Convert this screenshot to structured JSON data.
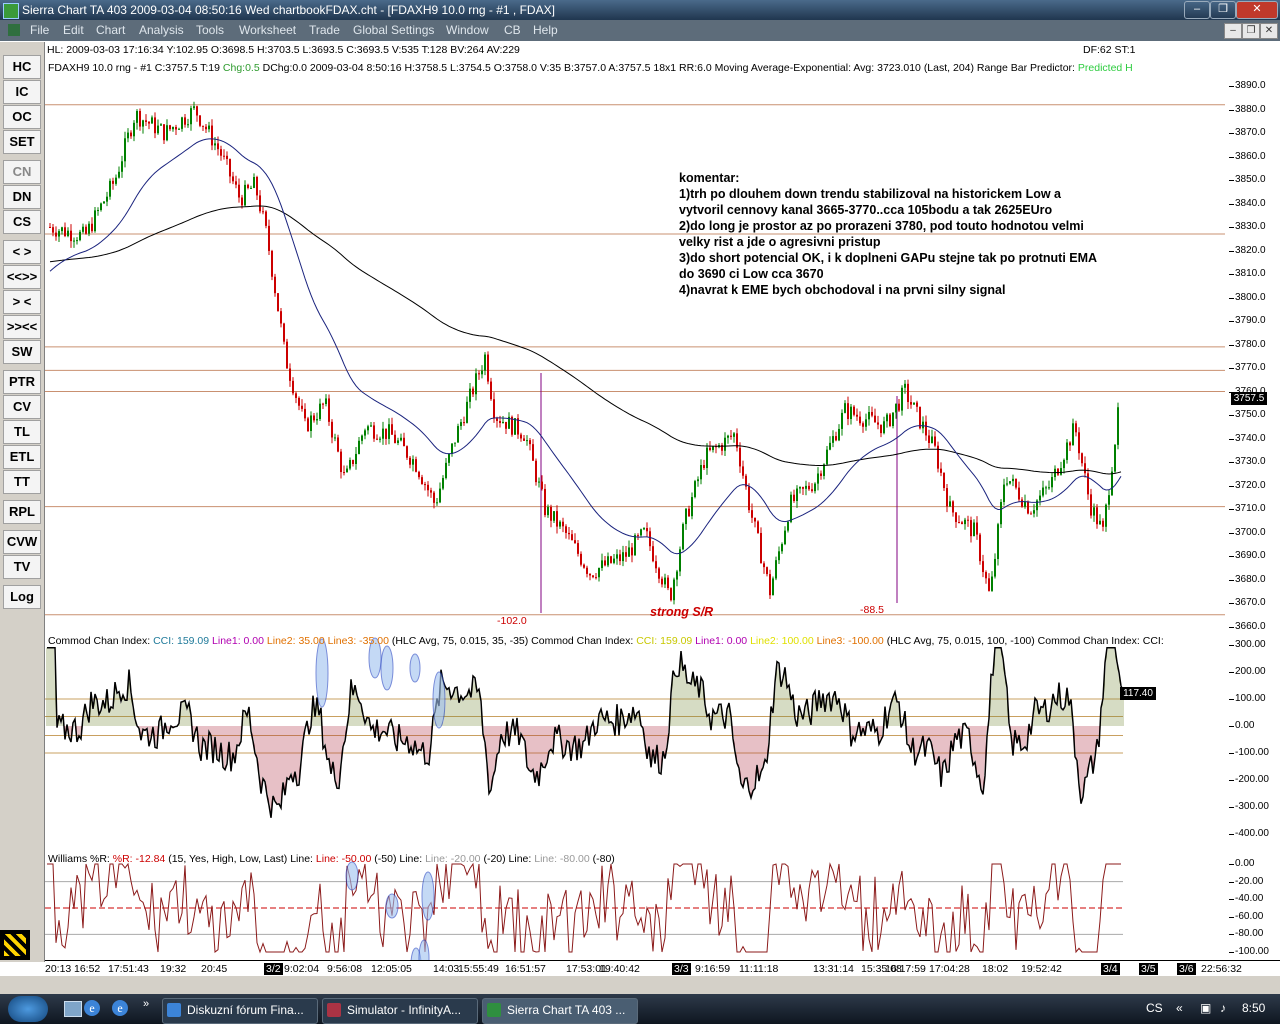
{
  "window": {
    "title": "Sierra Chart TA 403   2009-03-04  08:50:16  Wed   chartbookFDAX.cht - [FDAXH9  10.0 rng - #1 , FDAX]",
    "buttons": [
      "minimize-icon",
      "restore-icon",
      "close-icon"
    ]
  },
  "menu": {
    "items": [
      "File",
      "Edit",
      "Chart",
      "Analysis",
      "Tools",
      "Worksheet",
      "Trade",
      "Global Settings",
      "Window",
      "CB",
      "Help"
    ]
  },
  "infobar": {
    "left": "HL: 2009-03-03  17:16:34  Y:102.95  O:3698.5  H:3703.5  L:3693.5  C:3693.5  V:535  T:128  BV:264  AV:229",
    "right": "DF:62  ST:1"
  },
  "toolbar": {
    "buttons": [
      "HC",
      "IC",
      "OC",
      "SET",
      "CN",
      "DN",
      "CS",
      "< >",
      "<<>>",
      "> <",
      ">><<",
      "SW",
      "PTR",
      "CV",
      "TL",
      "ETL",
      "TT",
      "RPL",
      "CVW",
      "TV",
      "Log"
    ]
  },
  "price_chart": {
    "header_pre": "FDAXH9  10.0 rng - #1  C:3757.5  T:19  ",
    "header_chg": "Chg:0.5",
    "header_post": "  DChg:0.0  2009-03-04  8:50:16  H:3758.5  L:3754.5  O:3758.0  V:35  B:3757.0  A:3757.5  18x1  RR:6.0  Moving Average-Exponential:  Avg: 3723.010   (Last, 204)   Range Bar Predictor: ",
    "header_pred": "Predicted H",
    "last_price": "3757.5",
    "y_labels": [
      "3890.0",
      "3880.0",
      "3870.0",
      "3860.0",
      "3850.0",
      "3840.0",
      "3830.0",
      "3820.0",
      "3810.0",
      "3800.0",
      "3790.0",
      "3780.0",
      "3770.0",
      "3760.0",
      "3750.0",
      "3740.0",
      "3730.0",
      "3720.0",
      "3710.0",
      "3700.0",
      "3690.0",
      "3680.0",
      "3670.0",
      "3660.0"
    ],
    "annotations": {
      "label1": "-102.0",
      "label2": "strong S/R",
      "label3": "-88.5"
    },
    "komentar": "komentar:\n1)trh po dlouhem down trendu stabilizoval na historickem Low a\nvytvoril cennovy kanal 3665-3770..cca 105bodu a tak 2625EUro\n2)do long je prostor az po prorazeni 3780, pod touto hodnotou velmi\nvelky rist a jde o agresivni pristup\n3)do short potencial OK, i k doplneni GAPu stejne tak po protnuti EMA\ndo 3690 ci Low cca 3670\n4)navrat k EME bych obchodoval i na prvni silny signal"
  },
  "cci": {
    "h1": "Commod Chan Index:  ",
    "h2": "CCI: 159.09",
    "h3": "  Line1: 0.00",
    "h4": "  Line2: 35.00",
    "h5": "  Line3: -35.00",
    "h6": "   (HLC Avg, 75, 0.015, 35, -35)    Commod Chan Index:  ",
    "h7": "CCI: 159.09",
    "h8": "  Line1: 0.00",
    "h9": "  Line2: 100.00",
    "h10": "  Line3: -100.00",
    "h11": "   (HLC Avg, 75, 0.015, 100, -100)    Commod Chan Index:  CCI:",
    "value": "117.40",
    "y_labels": [
      "300.00",
      "200.00",
      "100.00",
      "0.00",
      "-100.00",
      "-200.00",
      "-300.00",
      "-400.00"
    ]
  },
  "williams": {
    "h1": "Williams %R:  ",
    "h2": "%R: -12.84",
    "h3": "   (15, Yes, High, Low, Last)    Line:  ",
    "h4": "Line: -50.00",
    "h5": "   (-50)    Line:  ",
    "h6": "Line: -20.00",
    "h7": "   (-20)    Line:  ",
    "h8": "Line: -80.00",
    "h9": "   (-80)",
    "y_labels": [
      "0.00",
      "-20.00",
      "-40.00",
      "-60.00",
      "-80.00",
      "-100.00"
    ]
  },
  "xaxis": {
    "labels": [
      "20:13",
      "16:52",
      "17:51:43",
      "19:32",
      "20:45",
      "3/2",
      "9:02:04",
      "9:56:08",
      "12:05:05",
      "14:03",
      "15:55:49",
      "16:51:57",
      "17:53:01",
      "19:40:42",
      "3/3",
      "9:16:59",
      "11:11:18",
      "13:31:14",
      "15:35:08",
      "16:17:59",
      "17:04:28",
      "18:02",
      "19:52:42",
      "3/4",
      "3/5",
      "3/6",
      "22:56:32"
    ]
  },
  "taskbar": {
    "tasks": [
      "Diskuzní fórum Fina...",
      "Simulator - InfinityA...",
      "Sierra Chart TA 403  ..."
    ],
    "lang": "CS",
    "time": "8:50"
  },
  "colors": {
    "up_bar": "#008000",
    "down_bar": "#cc0000",
    "ema": "#000000",
    "ma2": "#1a237e"
  }
}
